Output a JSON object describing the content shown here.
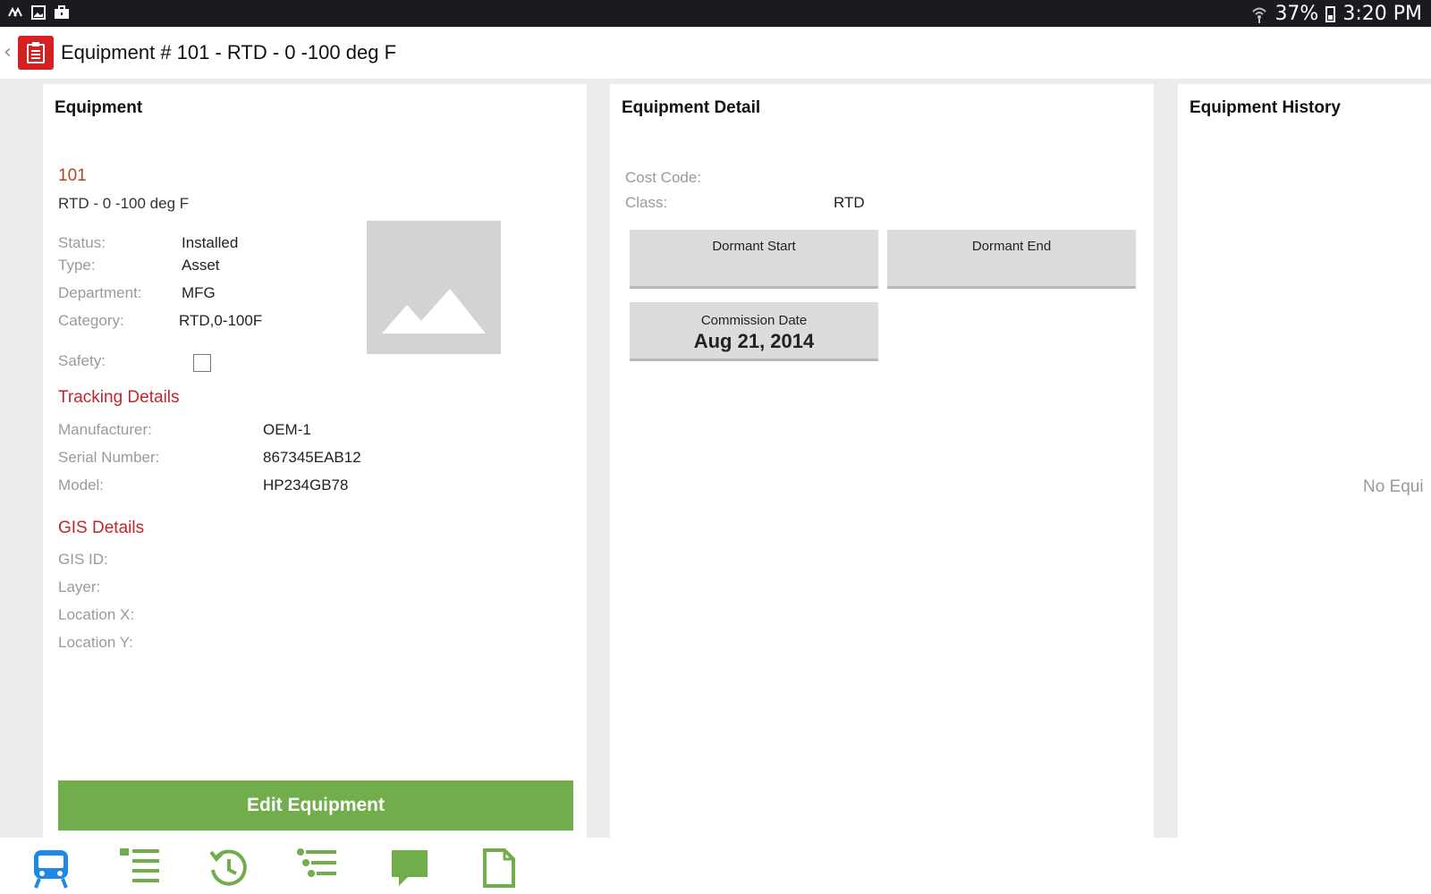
{
  "statusbar": {
    "left_icons": [
      "notification-icon",
      "gallery-icon",
      "briefcase-icon"
    ],
    "battery": "37%",
    "time": "3:20 PM"
  },
  "header": {
    "title": "Equipment # 101 - RTD - 0 -100 deg F",
    "app_icon": "clipboard-icon"
  },
  "equipment": {
    "heading": "Equipment",
    "id": "101",
    "description": "RTD - 0 -100 deg F",
    "fields": [
      {
        "label": "Status:",
        "value": "Installed"
      },
      {
        "label": "Type:",
        "value": "Asset"
      },
      {
        "label": "Department:",
        "value": "MFG"
      },
      {
        "label": "Category:",
        "value": "RTD,0-100F"
      }
    ],
    "safety_label": "Safety:",
    "safety_checked": false,
    "tracking": {
      "heading": "Tracking Details",
      "fields": [
        {
          "label": "Manufacturer:",
          "value": "OEM-1"
        },
        {
          "label": "Serial Number:",
          "value": "867345EAB12"
        },
        {
          "label": "Model:",
          "value": "HP234GB78"
        }
      ]
    },
    "gis": {
      "heading": "GIS Details",
      "fields": [
        {
          "label": "GIS ID:",
          "value": ""
        },
        {
          "label": "Layer:",
          "value": ""
        },
        {
          "label": "Location X:",
          "value": ""
        },
        {
          "label": "Location Y:",
          "value": ""
        }
      ]
    },
    "edit_button": "Edit Equipment"
  },
  "detail": {
    "heading": "Equipment Detail",
    "fields": [
      {
        "label": "Cost Code:",
        "value": ""
      },
      {
        "label": "Class:",
        "value": "RTD"
      }
    ],
    "dormant_start": "Dormant Start",
    "dormant_end": "Dormant End",
    "commission_caption": "Commission Date",
    "commission_date": "Aug 21, 2014"
  },
  "history": {
    "heading": "Equipment History",
    "empty_text": "No Equi"
  },
  "bottom_nav": [
    "equipment-icon",
    "list-icon",
    "history-icon",
    "tasks-icon",
    "comments-icon",
    "document-icon"
  ],
  "colors": {
    "accent_red": "#c0262d",
    "id_orange": "#b5451f",
    "edit_green": "#72ad4b",
    "nav_blue": "#1e88e5",
    "nav_green": "#72ad4b"
  }
}
